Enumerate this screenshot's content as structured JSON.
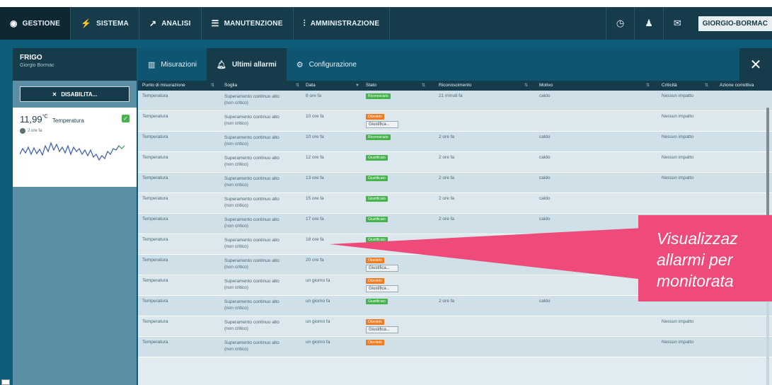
{
  "nav": {
    "items": [
      {
        "label": "GESTIONE",
        "icon": "eye-icon"
      },
      {
        "label": "SISTEMA",
        "icon": "bolt-icon"
      },
      {
        "label": "ANALISI",
        "icon": "chart-line-icon"
      },
      {
        "label": "MANUTENZIONE",
        "icon": "list-icon"
      },
      {
        "label": "AMMINISTRAZIONE",
        "icon": "sliders-icon"
      }
    ],
    "user": "GIORGIO-BORMAC"
  },
  "device": {
    "name": "FRIGO",
    "owner": "Giorgio Bormac",
    "disable_label": "DISABILITA..."
  },
  "sensor": {
    "value": "11,99",
    "unit": "°C",
    "label": "Temperatura",
    "time": "2 ore fa"
  },
  "tabs": [
    {
      "label": "Misurazioni",
      "icon": "bars-icon"
    },
    {
      "label": "Ultimi allarmi",
      "icon": "bell-icon"
    },
    {
      "label": "Configurazione",
      "icon": "gear-icon"
    }
  ],
  "table": {
    "headers": [
      "Punto di misurazione",
      "Soglia",
      "Data",
      "Stato",
      "Riconoscimento",
      "Motivo",
      "Criticità",
      "Azione correttiva"
    ],
    "giustifica_label": "Giustifica...",
    "rows": [
      {
        "punto": "Temperatura",
        "soglia1": "Superamento continuo alto",
        "soglia2": "(non critico)",
        "data": "8 ore fa",
        "stato": "Riconosciuto",
        "stato_color": "green",
        "giustifica": false,
        "ricon": "21 minuti fa",
        "motivo": "caldo",
        "criticita": "Nessun impatto"
      },
      {
        "punto": "Temperatura",
        "soglia1": "Superamento continuo alto",
        "soglia2": "(non critico)",
        "data": "10 ore fa",
        "stato": "Obsoleto",
        "stato_color": "orange",
        "giustifica": true,
        "ricon": "",
        "motivo": "",
        "criticita": "Nessun impatto"
      },
      {
        "punto": "Temperatura",
        "soglia1": "Superamento continuo alto",
        "soglia2": "(non critico)",
        "data": "10 ore fa",
        "stato": "Riconosciuto",
        "stato_color": "green",
        "giustifica": false,
        "ricon": "2 ore fa",
        "motivo": "caldo",
        "criticita": "Nessun impatto"
      },
      {
        "punto": "Temperatura",
        "soglia1": "Superamento continuo alto",
        "soglia2": "(non critico)",
        "data": "12 ore fa",
        "stato": "Giustificato",
        "stato_color": "green",
        "giustifica": false,
        "ricon": "2 ore fa",
        "motivo": "caldo",
        "criticita": "Nessun impatto"
      },
      {
        "punto": "Temperatura",
        "soglia1": "Superamento continuo alto",
        "soglia2": "(non critico)",
        "data": "13 ore fa",
        "stato": "Giustificato",
        "stato_color": "green",
        "giustifica": false,
        "ricon": "2 ore fa",
        "motivo": "caldo",
        "criticita": "Nessun impatto"
      },
      {
        "punto": "Temperatura",
        "soglia1": "Superamento continuo alto",
        "soglia2": "(non critico)",
        "data": "15 ore fa",
        "stato": "Giustificato",
        "stato_color": "green",
        "giustifica": false,
        "ricon": "2 ore fa",
        "motivo": "caldo",
        "criticita": ""
      },
      {
        "punto": "Temperatura",
        "soglia1": "Superamento continuo alto",
        "soglia2": "(non critico)",
        "data": "17 ore fa",
        "stato": "Giustificato",
        "stato_color": "green",
        "giustifica": false,
        "ricon": "2 ore fa",
        "motivo": "caldo",
        "criticita": ""
      },
      {
        "punto": "Temperatura",
        "soglia1": "Superamento continuo alto",
        "soglia2": "(non critico)",
        "data": "18 ore fa",
        "stato": "Giustificato",
        "stato_color": "green",
        "giustifica": false,
        "ricon": "",
        "motivo": "",
        "criticita": ""
      },
      {
        "punto": "Temperatura",
        "soglia1": "Superamento continuo alto",
        "soglia2": "(non critico)",
        "data": "20 ore fa",
        "stato": "Obsoleto",
        "stato_color": "orange",
        "giustifica": true,
        "ricon": "",
        "motivo": "",
        "criticita": ""
      },
      {
        "punto": "Temperatura",
        "soglia1": "Superamento continuo alto",
        "soglia2": "(non critico)",
        "data": "un giorno fa",
        "stato": "Obsoleto",
        "stato_color": "orange",
        "giustifica": true,
        "ricon": "",
        "motivo": "",
        "criticita": ""
      },
      {
        "punto": "Temperatura",
        "soglia1": "Superamento continuo alto",
        "soglia2": "(non critico)",
        "data": "un giorno fa",
        "stato": "Giustificato",
        "stato_color": "green",
        "giustifica": false,
        "ricon": "2 ore fa",
        "motivo": "caldo",
        "criticita": ""
      },
      {
        "punto": "Temperatura",
        "soglia1": "Superamento continuo alto",
        "soglia2": "(non critico)",
        "data": "un giorno fa",
        "stato": "Obsoleto",
        "stato_color": "orange",
        "giustifica": true,
        "ricon": "",
        "motivo": "",
        "criticita": "Nessun impatto"
      },
      {
        "punto": "Temperatura",
        "soglia1": "Superamento continuo alto",
        "soglia2": "(non critico)",
        "data": "un giorno fa",
        "stato": "Obsoleto",
        "stato_color": "orange",
        "giustifica": false,
        "ricon": "",
        "motivo": "",
        "criticita": "Nessun impatto"
      }
    ]
  },
  "callout": {
    "line1": "Visualizzaz",
    "line2": "allarmi per",
    "line3": "monitorata"
  }
}
